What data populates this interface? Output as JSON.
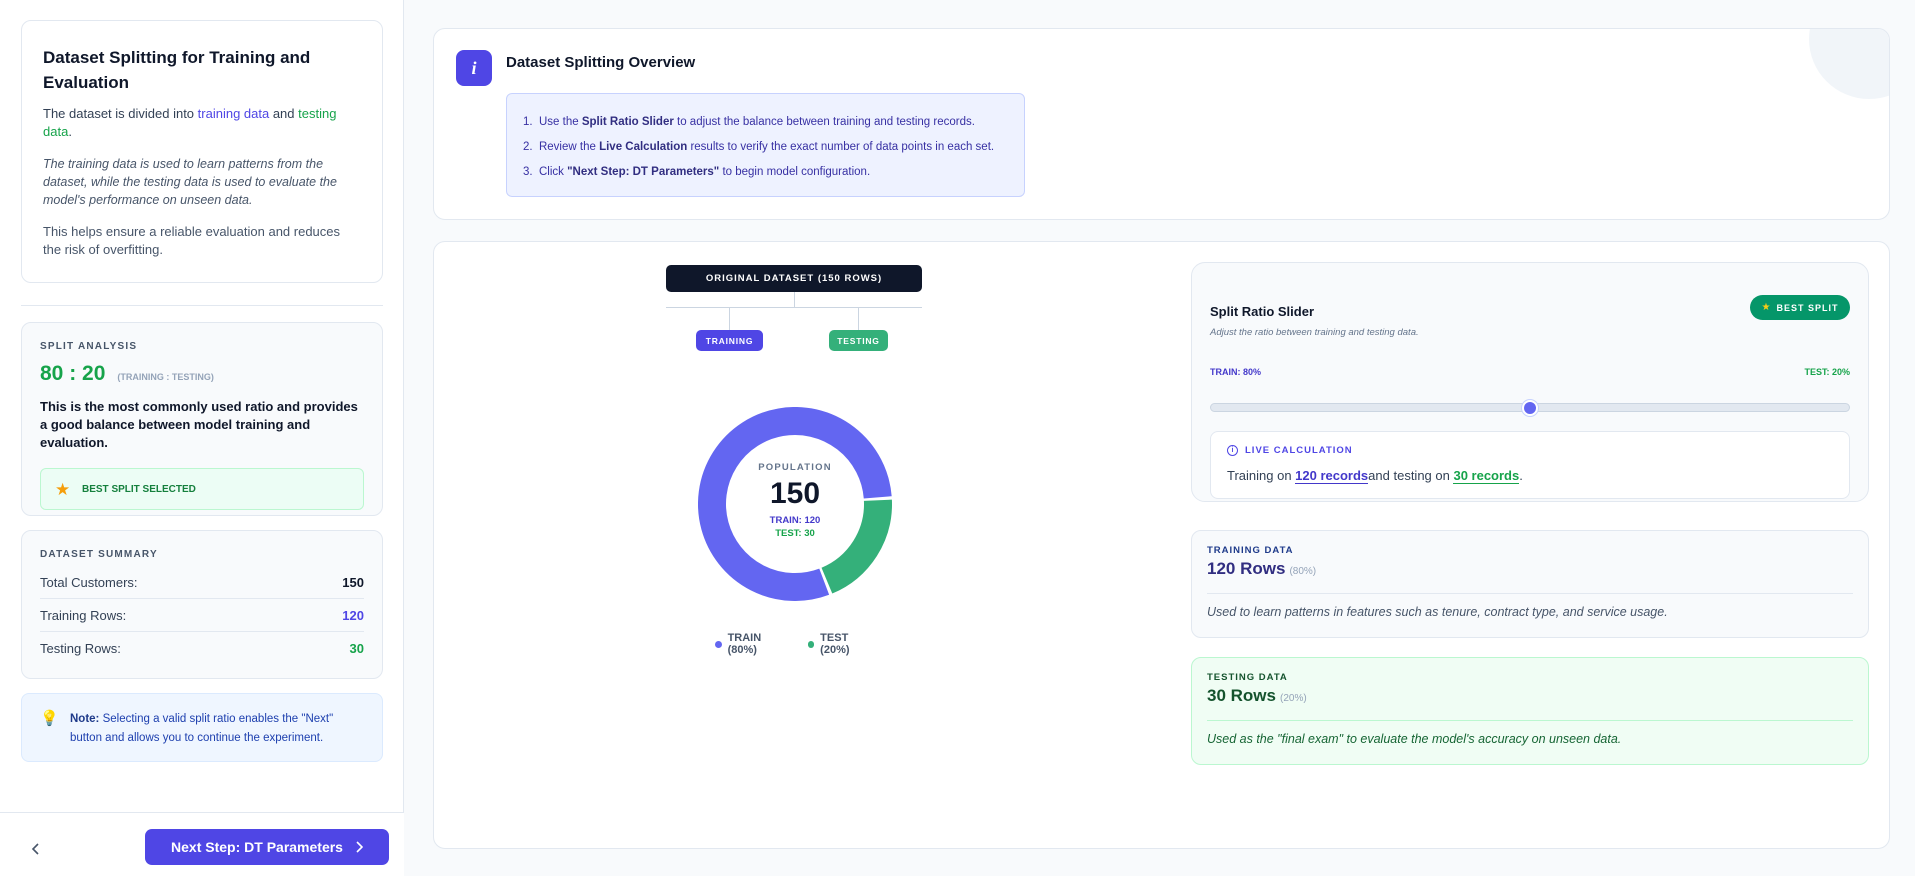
{
  "sidebar": {
    "intro": {
      "title": "Dataset Splitting for Training and Evaluation",
      "p1_prefix": "The dataset is divided into ",
      "p1_train": "training data",
      "p1_and": " and ",
      "p1_test": "testing data",
      "p1_suffix": ".",
      "p2": "The training data is used to learn patterns from the dataset, while the testing data is used to evaluate the model's performance on unseen data.",
      "p3": "This helps ensure a reliable evaluation and reduces the risk of overfitting."
    },
    "analysis": {
      "label": "SPLIT ANALYSIS",
      "ratio": "80 : 20",
      "ratio_sub": "(TRAINING : TESTING)",
      "description": "This is the most commonly used ratio and provides a good balance between model training and evaluation.",
      "best_label": "BEST SPLIT SELECTED"
    },
    "summary": {
      "label": "DATASET SUMMARY",
      "rows": [
        {
          "label": "Total Customers:",
          "value": "150"
        },
        {
          "label": "Training Rows:",
          "value": "120"
        },
        {
          "label": "Testing Rows:",
          "value": "30"
        }
      ]
    },
    "note": {
      "bold": "Note:",
      "text": " Selecting a valid split ratio enables the \"Next\" button and allows you to continue the experiment."
    },
    "footer": {
      "back_icon": "chevron-left-icon",
      "next_label": "Next Step: DT Parameters"
    }
  },
  "overview": {
    "title": "Dataset Splitting Overview",
    "steps": [
      {
        "num": "1.",
        "pre": "Use the ",
        "bold": "Split Ratio Slider",
        "post": " to adjust the balance between training and testing records."
      },
      {
        "num": "2.",
        "pre": "Review the ",
        "bold": "Live Calculation",
        "post": " results to verify the exact number of data points in each set."
      },
      {
        "num": "3.",
        "pre": "Click ",
        "bold": "\"Next Step: DT Parameters\"",
        "post": " to begin model configuration."
      }
    ]
  },
  "diagram": {
    "dataset_label": "ORIGINAL DATASET (150 ROWS)",
    "train_pill": "TRAINING",
    "test_pill": "TESTING"
  },
  "chart_data": {
    "type": "pie",
    "categories": [
      "TRAIN (80%)",
      "TEST (20%)"
    ],
    "values": [
      120,
      30
    ],
    "center_label": "POPULATION",
    "center_value": "150",
    "center_train": "TRAIN: 120",
    "center_test": "TEST: 30",
    "colors": [
      "#6366f1",
      "#34b07a"
    ]
  },
  "slider": {
    "title": "Split Ratio Slider",
    "subtitle": "Adjust the ratio between training and testing data.",
    "best_badge": "BEST SPLIT",
    "train_label": "TRAIN: 80%",
    "test_label": "TEST: 20%",
    "value_percent": 50,
    "live_label": "LIVE CALCULATION",
    "live_pre": "Training on ",
    "live_train": "120 records",
    "live_mid": "and testing on ",
    "live_test": "30 records",
    "live_end": "."
  },
  "training_card": {
    "label": "TRAINING DATA",
    "rows": "120 Rows",
    "pct": "(80%)",
    "desc": "Used to learn patterns in features such as tenure, contract type, and service usage."
  },
  "testing_card": {
    "label": "TESTING DATA",
    "rows": "30 Rows",
    "pct": "(20%)",
    "desc": "Used as the \"final exam\" to evaluate the model's accuracy on unseen data."
  },
  "colors": {
    "accent": "#4f46e5",
    "train": "#6366f1",
    "test": "#34b07a"
  }
}
